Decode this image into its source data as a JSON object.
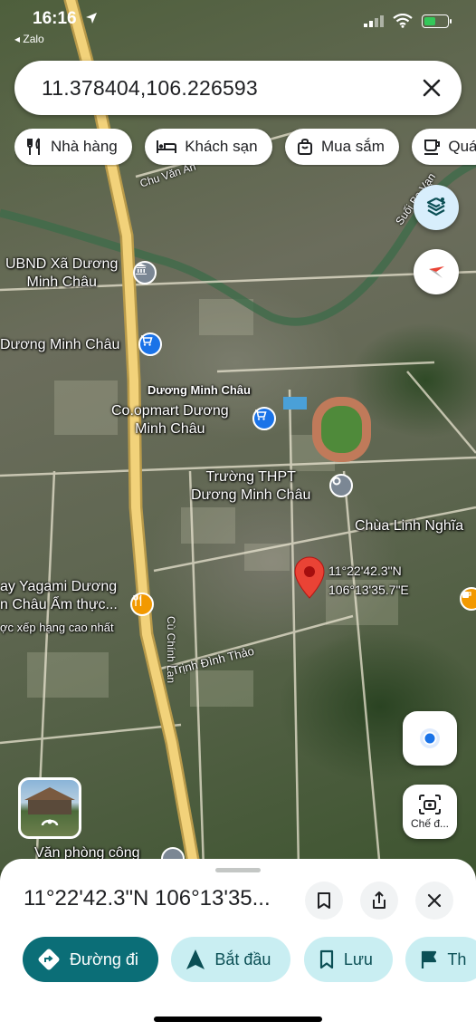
{
  "status_bar": {
    "time": "16:16",
    "back_app": "◂ Zalo"
  },
  "search": {
    "query": "11.378404,106.226593",
    "clear_icon": "close-icon"
  },
  "chips": [
    {
      "label": "Nhà hàng",
      "icon": "restaurant-icon"
    },
    {
      "label": "Khách sạn",
      "icon": "hotel-icon"
    },
    {
      "label": "Mua sắm",
      "icon": "shopping-bag-icon"
    },
    {
      "label": "Quá",
      "icon": "coffee-icon"
    }
  ],
  "map": {
    "labels": {
      "ubnd": "UBND Xã Dương\nMinh Châu",
      "store_left": "Dương Minh Châu",
      "area": "Dương Minh Châu",
      "coopmart": "Co.opmart Dương\nMinh Châu",
      "school": "Trường THPT\nDương Minh Châu",
      "pagoda": "Chùa Linh Nghĩa",
      "restaurant": "ay Yagami Dương\nn Châu Ẩm thực...",
      "restaurant_sub": "ợc xếp hạng cao nhất",
      "office": "Văn phòng công",
      "pin_coords": "11°22'42.3\"N\n106°13'35.7\"E"
    },
    "streets": {
      "chu_van_an": "Chu Văn An",
      "cu_chinh_lan": "Cù Chính Lan",
      "trinh_dinh_thao": "Trịnh Đình Thảo",
      "suoi": "Suối Ba Vạn"
    },
    "pin_color": "#ea4335"
  },
  "floating": {
    "street_view_label": "Chế đ..."
  },
  "sheet": {
    "title": "11°22'42.3\"N 106°13'35...",
    "actions": [
      {
        "label": "Đường đi",
        "icon": "directions-icon",
        "style": "primary"
      },
      {
        "label": "Bắt đầu",
        "icon": "navigation-arrow-icon",
        "style": "tonal"
      },
      {
        "label": "Lưu",
        "icon": "bookmark-icon",
        "style": "tonal"
      },
      {
        "label": "Th",
        "icon": "flag-icon",
        "style": "tonal"
      }
    ]
  },
  "colors": {
    "primary": "#0b6e77",
    "tonal": "#c9eef2",
    "road_main": "#f2d27a"
  }
}
